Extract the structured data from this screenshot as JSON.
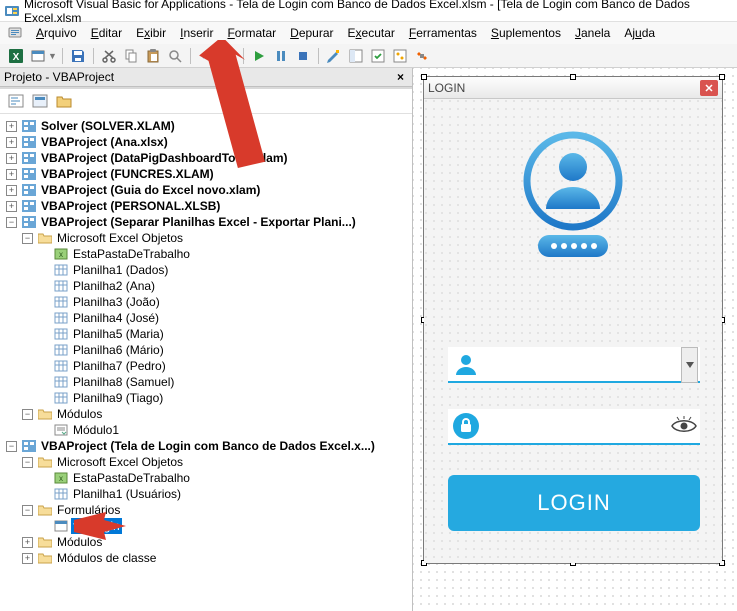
{
  "title": "Microsoft Visual Basic for Applications - Tela de Login com Banco de Dados Excel.xlsm - [Tela de Login com Banco de Dados Excel.xlsm",
  "menu": [
    "Arquivo",
    "Editar",
    "Exibir",
    "Inserir",
    "Formatar",
    "Depurar",
    "Executar",
    "Ferramentas",
    "Suplementos",
    "Janela",
    "Ajuda"
  ],
  "project_panel": {
    "title": "Projeto - VBAProject",
    "close": "×"
  },
  "tree": {
    "solver": "Solver (SOLVER.XLAM)",
    "ana": "VBAProject (Ana.xlsx)",
    "datapig": "VBAProject (DataPigDashboardTools.xlam)",
    "funcres": "VBAProject (FUNCRES.XLAM)",
    "guia": "VBAProject (Guia do Excel novo.xlam)",
    "personal": "VBAProject (PERSONAL.XLSB)",
    "separar": "VBAProject (Separar Planilhas Excel - Exportar Plani...)",
    "sep_objetos": "Microsoft Excel Objetos",
    "sep_pasta": "EstaPastaDeTrabalho",
    "sep_p1": "Planilha1 (Dados)",
    "sep_p2": "Planilha2 (Ana)",
    "sep_p3": "Planilha3 (João)",
    "sep_p4": "Planilha4 (José)",
    "sep_p5": "Planilha5 (Maria)",
    "sep_p6": "Planilha6 (Mário)",
    "sep_p7": "Planilha7 (Pedro)",
    "sep_p8": "Planilha8 (Samuel)",
    "sep_p9": "Planilha9 (Tiago)",
    "sep_mods": "Módulos",
    "sep_mod1": "Módulo1",
    "tela": "VBAProject (Tela de Login com Banco de Dados Excel.x...)",
    "tela_objetos": "Microsoft Excel Objetos",
    "tela_pasta": "EstaPastaDeTrabalho",
    "tela_p1": "Planilha1 (Usuários)",
    "tela_forms": "Formulários",
    "tela_frm": "frmLogin",
    "tela_mods": "Módulos",
    "tela_modclass": "Módulos de classe"
  },
  "form": {
    "title": "LOGIN",
    "button": "LOGIN"
  }
}
